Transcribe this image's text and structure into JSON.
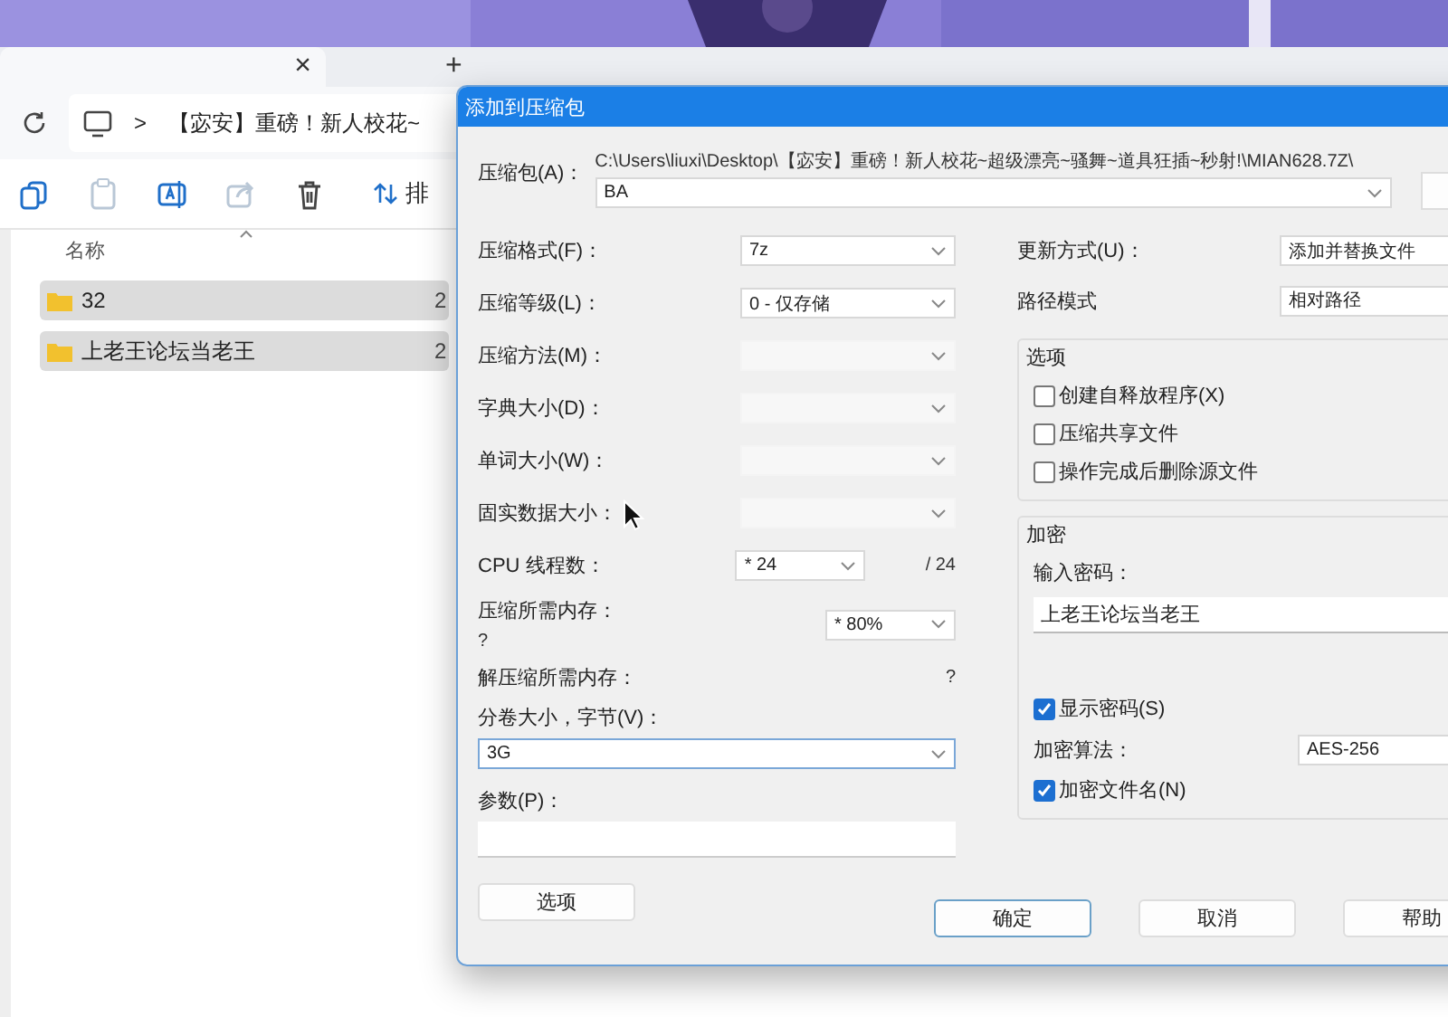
{
  "browser_tabs": {
    "close": "×",
    "new_tab": "+"
  },
  "address_bar": {
    "separator": ">",
    "path": "【宓安】重磅！新人校花~"
  },
  "toolbar": {
    "buttons": [
      {
        "kind": "copy",
        "disabled": false
      },
      {
        "kind": "paste",
        "disabled": true
      },
      {
        "kind": "rename",
        "disabled": false
      },
      {
        "kind": "share",
        "disabled": true
      },
      {
        "kind": "delete",
        "disabled": false
      }
    ],
    "sort_label": "排"
  },
  "file_list": {
    "column_name": "名称",
    "rows": [
      {
        "name": "32",
        "column_2": "2",
        "selected": true
      },
      {
        "name": "上老王论坛当老王",
        "column_2": "2",
        "selected": true
      }
    ]
  },
  "dialog": {
    "title": "添加到压缩包",
    "archive_label": "压缩包(A)：",
    "archive_path": "C:\\Users\\liuxi\\Desktop\\【宓安】重磅！新人校花~超级漂亮~骚舞~道具狂插~秒射!\\MIAN628.7Z\\",
    "archive_name": "BA",
    "left_fields": [
      {
        "kind": "select",
        "label": "压缩格式(F)：",
        "value": "7z",
        "disabled": false
      },
      {
        "kind": "select",
        "label": "压缩等级(L)：",
        "value": "0 - 仅存储",
        "disabled": false
      },
      {
        "kind": "select",
        "label": "压缩方法(M)：",
        "disabled": true
      },
      {
        "kind": "select",
        "label": "字典大小(D)：",
        "disabled": true
      },
      {
        "kind": "select",
        "label": "单词大小(W)：",
        "disabled": true
      },
      {
        "kind": "select",
        "label": "固实数据大小：",
        "disabled": true
      },
      {
        "kind": "threads",
        "label": "CPU 线程数：",
        "value": "* 24",
        "suffix": "/ 24"
      },
      {
        "kind": "memory",
        "label": "压缩所需内存：",
        "note": "?",
        "value": "* 80%"
      },
      {
        "kind": "info",
        "label": "解压缩所需内存：",
        "note": "?"
      },
      {
        "kind": "wide_select",
        "label": "分卷大小，字节(V)：",
        "value": "3G"
      },
      {
        "kind": "text_input",
        "label": "参数(P)："
      }
    ],
    "options_button": "选项",
    "update_mode": {
      "label": "更新方式(U)：",
      "value": "添加并替换文件"
    },
    "path_mode": {
      "label": "路径模式",
      "value": "相对路径"
    },
    "options_group": {
      "title": "选项",
      "checkboxes": [
        {
          "label": "创建自释放程序(X)",
          "checked": false
        },
        {
          "label": "压缩共享文件",
          "checked": false
        },
        {
          "label": "操作完成后删除源文件",
          "checked": false
        }
      ]
    },
    "encryption": {
      "title": "加密",
      "password_label": "输入密码：",
      "password": "上老王论坛当老王",
      "show_password": {
        "label": "显示密码(S)",
        "checked": true
      },
      "method_label": "加密算法：",
      "method": "AES-256",
      "encrypt_names": {
        "label": "加密文件名(N)",
        "checked": true
      }
    },
    "buttons": [
      {
        "label": "确定",
        "default": true
      },
      {
        "label": "取消",
        "default": false
      },
      {
        "label": "帮助",
        "default": false
      }
    ]
  }
}
